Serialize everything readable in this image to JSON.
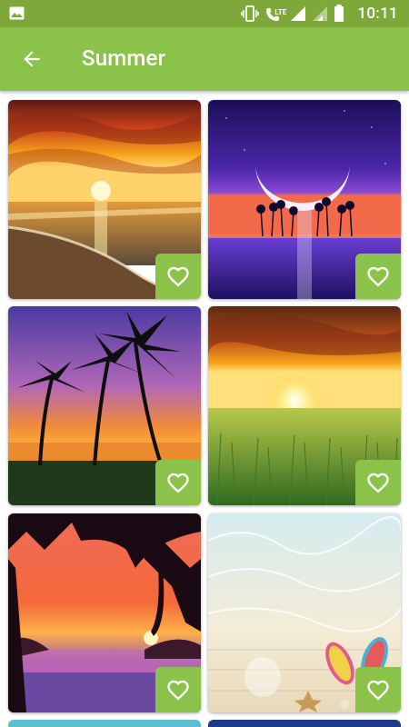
{
  "status_bar": {
    "time": "10:11",
    "network": "LTE",
    "icons": [
      "gallery-icon",
      "vibrate-icon",
      "lte-call-icon",
      "signal-icon",
      "signal-icon",
      "battery-icon"
    ]
  },
  "app_bar": {
    "title": "Summer",
    "back_icon": "arrow-back-icon"
  },
  "wallpapers": [
    {
      "scene": "sunset over ocean beach",
      "favorite_icon": "heart-outline-icon"
    },
    {
      "scene": "crescent moon with palm island",
      "favorite_icon": "heart-outline-icon"
    },
    {
      "scene": "palm trees at sunset",
      "favorite_icon": "heart-outline-icon"
    },
    {
      "scene": "sunset over green field",
      "favorite_icon": "heart-outline-icon"
    },
    {
      "scene": "palm silhouettes tropical sunset",
      "favorite_icon": "heart-outline-icon"
    },
    {
      "scene": "sandals and shells on water",
      "favorite_icon": "heart-outline-icon"
    }
  ],
  "colors": {
    "status_bar": "#7fa83a",
    "app_bar": "#8bc34a",
    "favorite_button": "#8bc34a"
  }
}
